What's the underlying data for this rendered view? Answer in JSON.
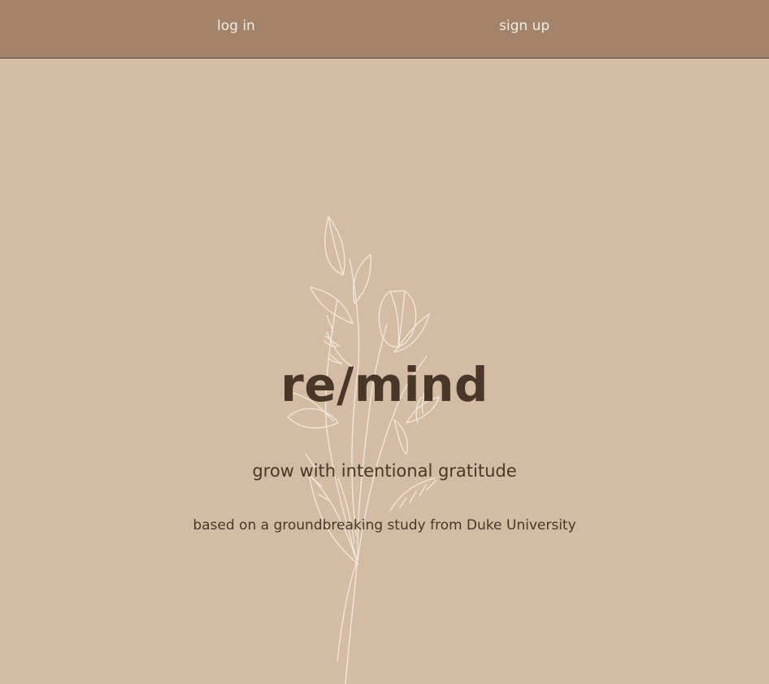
{
  "nav": {
    "login_label": "log in",
    "signup_label": "sign up"
  },
  "hero": {
    "brand": "re/mind",
    "tagline": "grow with intentional gratitude",
    "subtext": "based on a groundbreaking study from Duke University",
    "illustration": "floral-bouquet-line-art"
  },
  "colors": {
    "navbar_bg": "#a3846b",
    "page_bg": "#d4bca4",
    "nav_text": "#f3ece4",
    "body_text": "#4a3628",
    "illustration_stroke": "#f6ede4"
  }
}
